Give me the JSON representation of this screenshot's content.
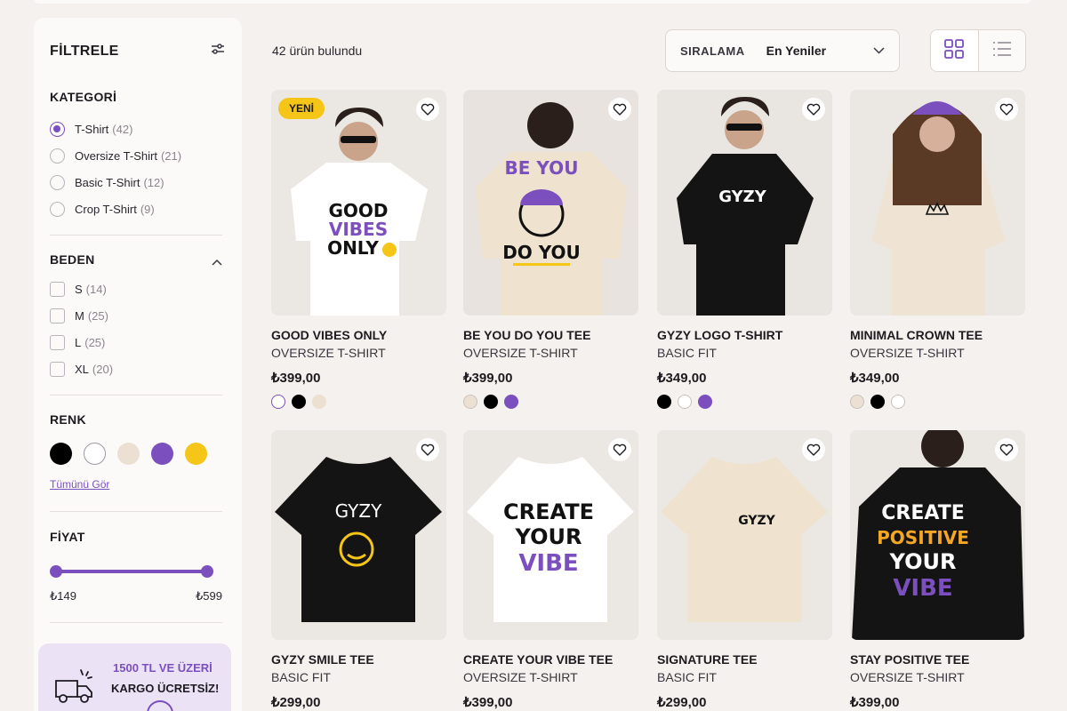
{
  "sidebar": {
    "title": "FİLTRELE",
    "category": {
      "title": "KATEGORİ",
      "items": [
        {
          "label": "T-Shirt",
          "count": "(42)",
          "selected": true
        },
        {
          "label": "Oversize T-Shirt",
          "count": "(21)",
          "selected": false
        },
        {
          "label": "Basic T-Shirt",
          "count": "(12)",
          "selected": false
        },
        {
          "label": "Crop T-Shirt",
          "count": "(9)",
          "selected": false
        }
      ]
    },
    "size": {
      "title": "BEDEN",
      "items": [
        {
          "label": "S",
          "count": "(14)"
        },
        {
          "label": "M",
          "count": "(25)"
        },
        {
          "label": "L",
          "count": "(25)"
        },
        {
          "label": "XL",
          "count": "(20)"
        }
      ]
    },
    "color": {
      "title": "RENK",
      "swatches": [
        "#000000",
        "#ffffff",
        "#ebe0d2",
        "#7b4fbd",
        "#f5c518"
      ],
      "see_all": "Tümünü Gör"
    },
    "price": {
      "title": "FİYAT",
      "min": "₺149",
      "max": "₺599"
    },
    "promo": {
      "line1": "1500 TL VE ÜZERİ",
      "line2": "KARGO ÜCRETSİZ!"
    }
  },
  "toolbar": {
    "result_count": "42 ürün bulundu",
    "sort_label": "SIRALAMA",
    "sort_value": "En Yeniler"
  },
  "products": [
    {
      "name": "GOOD VIBES ONLY",
      "category": "OVERSIZE T-SHIRT",
      "price": "₺399,00",
      "badge": "YENİ",
      "colors": [
        "#ffffff",
        "#000000",
        "#ebe0d2"
      ]
    },
    {
      "name": "BE YOU DO YOU TEE",
      "category": "OVERSIZE T-SHIRT",
      "price": "₺399,00",
      "badge": "",
      "colors": [
        "#ebe0d2",
        "#000000",
        "#7b4fbd"
      ]
    },
    {
      "name": "GYZY LOGO T-SHIRT",
      "category": "BASIC FIT",
      "price": "₺349,00",
      "badge": "",
      "colors": [
        "#000000",
        "#ffffff",
        "#7b4fbd"
      ]
    },
    {
      "name": "MINIMAL CROWN TEE",
      "category": "OVERSIZE T-SHIRT",
      "price": "₺349,00",
      "badge": "",
      "colors": [
        "#ebe0d2",
        "#000000",
        "#ffffff"
      ]
    },
    {
      "name": "GYZY SMILE TEE",
      "category": "BASIC FIT",
      "price": "₺299,00",
      "badge": "",
      "colors": []
    },
    {
      "name": "CREATE YOUR VIBE TEE",
      "category": "OVERSIZE T-SHIRT",
      "price": "₺399,00",
      "badge": "",
      "colors": []
    },
    {
      "name": "SIGNATURE TEE",
      "category": "BASIC FIT",
      "price": "₺299,00",
      "badge": "",
      "colors": []
    },
    {
      "name": "STAY POSITIVE TEE",
      "category": "OVERSIZE T-SHIRT",
      "price": "₺399,00",
      "badge": "",
      "colors": []
    }
  ],
  "print_text": {
    "p1": [
      "GOOD",
      "VIBES",
      "ONLY"
    ],
    "p2": [
      "BE YOU",
      "DO YOU"
    ],
    "p3": "GYZY",
    "p5": "GYZY",
    "p6": [
      "CREATE",
      "YOUR",
      "VIBE"
    ],
    "p7": "GYZY",
    "p8": [
      "CREATE",
      "POSITIVE",
      "YOUR",
      "VIBE"
    ]
  }
}
